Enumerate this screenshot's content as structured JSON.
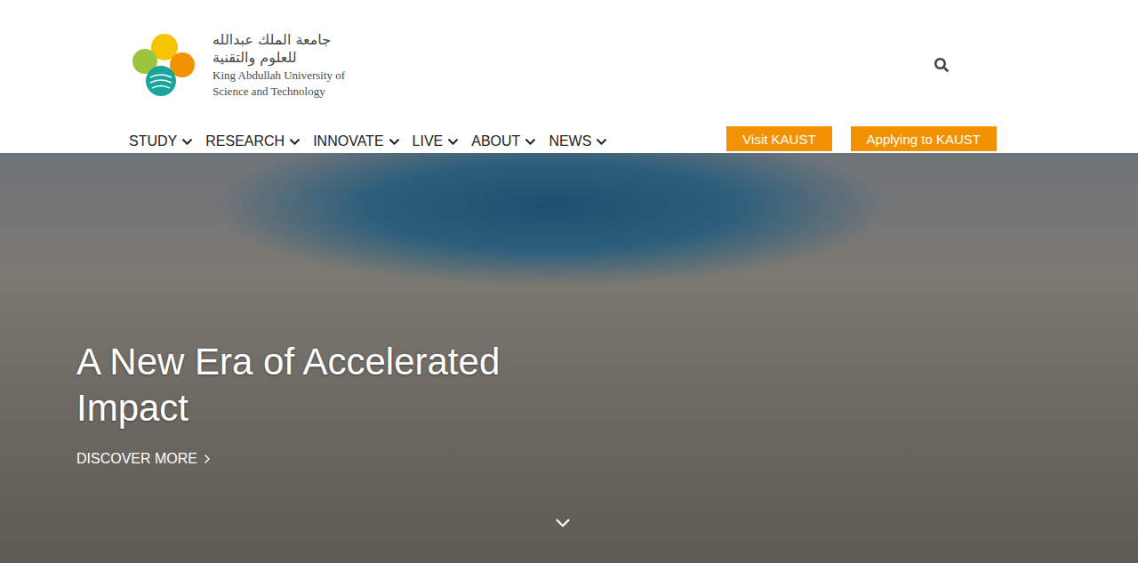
{
  "logo": {
    "arabic": [
      "جامعة الملك عبدالله",
      "للعلوم والتقنية"
    ],
    "english": [
      "King Abdullah University of",
      "Science and Technology"
    ]
  },
  "nav": [
    {
      "label": "STUDY"
    },
    {
      "label": "RESEARCH"
    },
    {
      "label": "INNOVATE"
    },
    {
      "label": "LIVE"
    },
    {
      "label": "ABOUT"
    },
    {
      "label": "NEWS"
    }
  ],
  "buttons": [
    "Visit KAUST",
    "Applying to KAUST"
  ],
  "hero": {
    "title": "A New Era of Accelerated Impact",
    "cta": "DISCOVER MORE"
  }
}
